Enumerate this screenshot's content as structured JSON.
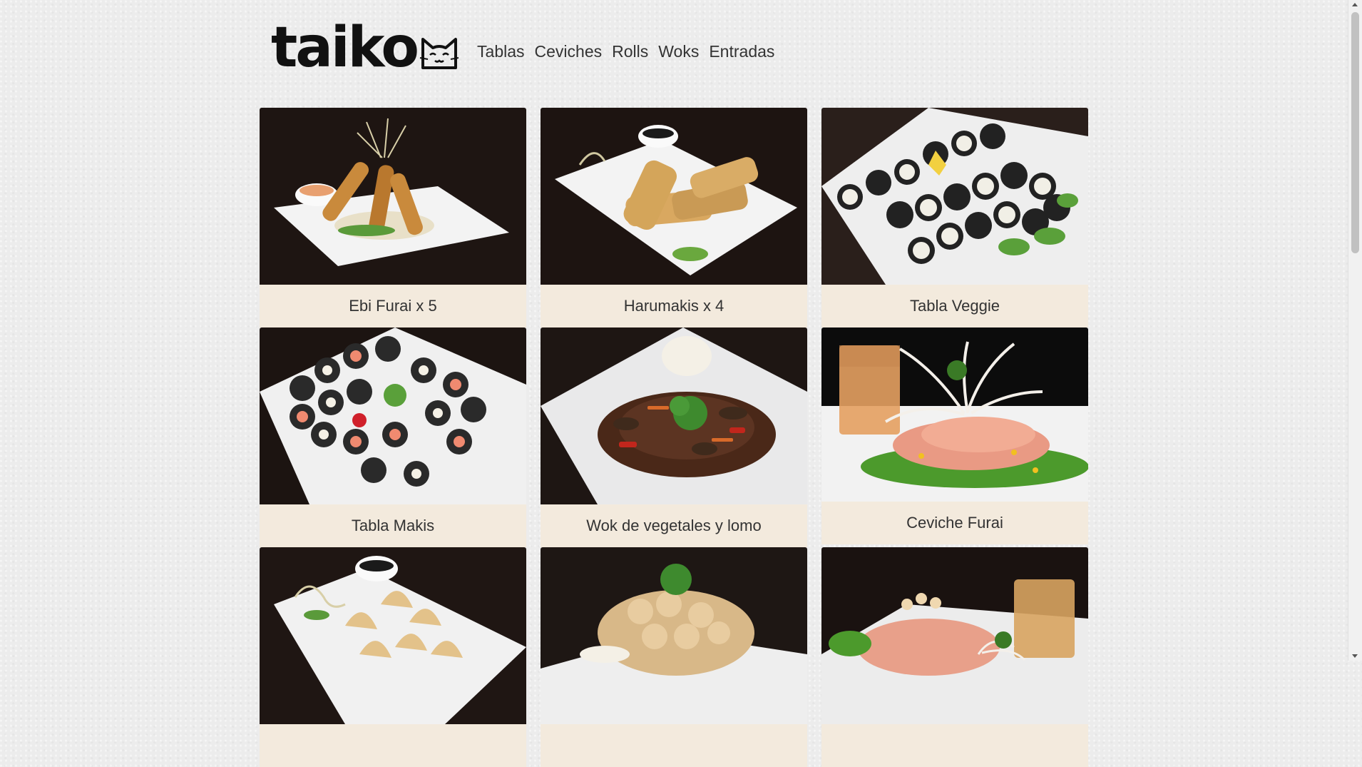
{
  "brand": {
    "name": "taiko",
    "mascot_icon": "cat-face-icon"
  },
  "nav": {
    "items": [
      "Tablas",
      "Ceviches",
      "Rolls",
      "Woks",
      "Entradas"
    ]
  },
  "products": [
    {
      "name": "Ebi Furai x 5"
    },
    {
      "name": "Harumakis x 4"
    },
    {
      "name": "Tabla Veggie"
    },
    {
      "name": "Tabla Makis"
    },
    {
      "name": "Wok de vegetales y lomo"
    },
    {
      "name": "Ceviche Furai"
    },
    {
      "name": ""
    },
    {
      "name": ""
    },
    {
      "name": ""
    }
  ],
  "colors": {
    "caption_bg": "#f3eadd",
    "photo_bg": "#1e1512",
    "text": "#333333"
  }
}
